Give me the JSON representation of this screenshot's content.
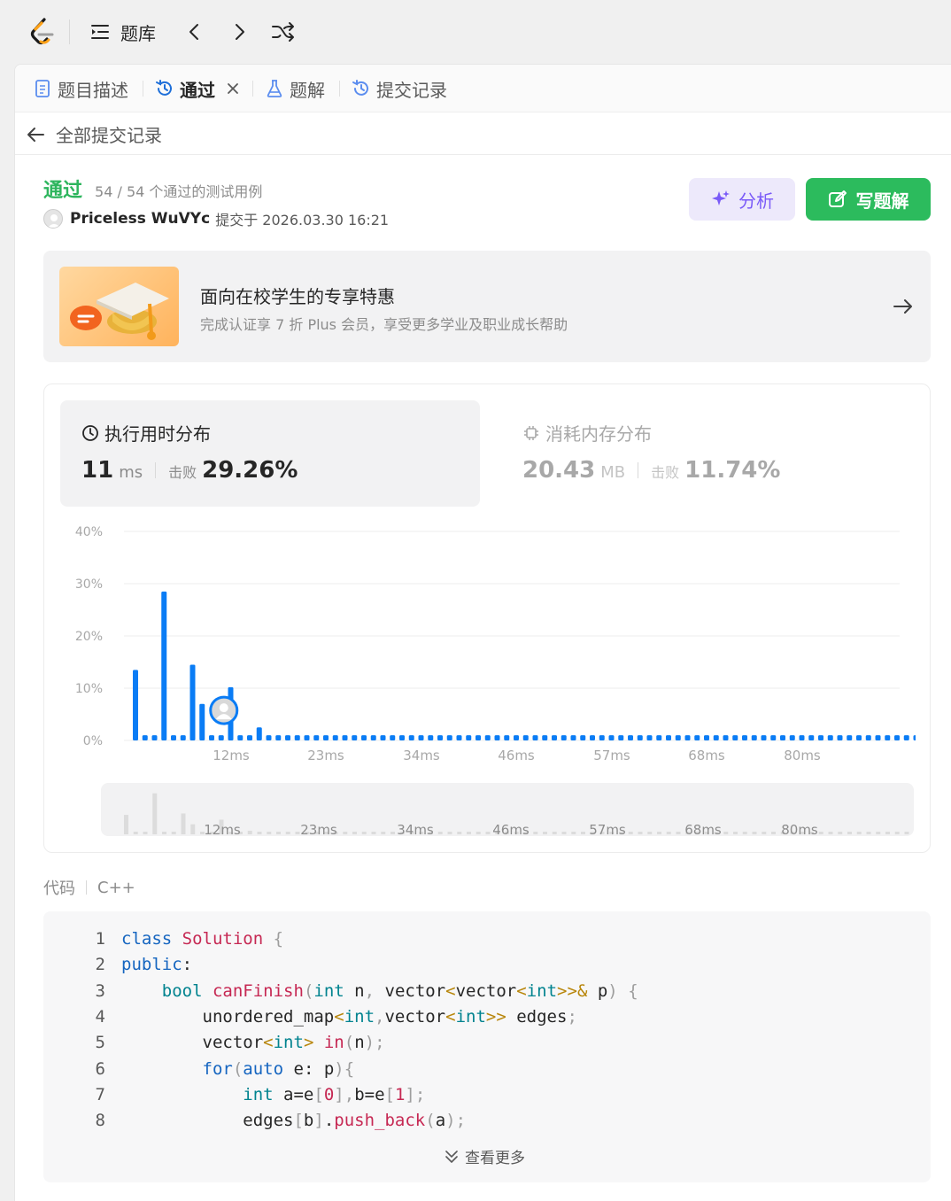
{
  "topbar": {
    "problems_label": "题库"
  },
  "tabs": [
    {
      "label": "题目描述",
      "icon": "document-icon"
    },
    {
      "label": "通过",
      "icon": "history-icon"
    },
    {
      "label": "题解",
      "icon": "flask-icon"
    },
    {
      "label": "提交记录",
      "icon": "history-icon"
    }
  ],
  "subheader": {
    "back_label": "全部提交记录"
  },
  "submission": {
    "status": "通过",
    "detail": "54 / 54 个通过的测试用例",
    "author": "Priceless WuVYc",
    "submitted": "提交于 2026.03.30 16:21"
  },
  "actions": {
    "analyze_label": "分析",
    "write_label": "写题解"
  },
  "promo": {
    "title": "面向在校学生的专享特惠",
    "subtitle": "完成认证享 7 折 Plus 会员，享受更多学业及职业成长帮助"
  },
  "runtime": {
    "title": "执行用时分布",
    "value": "11",
    "unit": "ms",
    "beat_label": "击败",
    "beat": "29.26%"
  },
  "memory": {
    "title": "消耗内存分布",
    "value": "20.43",
    "unit": "MB",
    "beat_label": "击败",
    "beat": "11.74%"
  },
  "chart_data": {
    "type": "bar",
    "ylabel_ticks": [
      "0%",
      "10%",
      "20%",
      "30%",
      "40%"
    ],
    "ylim": [
      0,
      40
    ],
    "xticks": [
      "12ms",
      "23ms",
      "34ms",
      "46ms",
      "57ms",
      "68ms",
      "80ms"
    ],
    "values": [
      13.5,
      1,
      1,
      28.5,
      1,
      1,
      14.5,
      7,
      1,
      1,
      10.2,
      1,
      1,
      2.5,
      1,
      1,
      1,
      1,
      1,
      1,
      1,
      1,
      1,
      1,
      1,
      1,
      1,
      1,
      1,
      1,
      1,
      1,
      1,
      1,
      1,
      1,
      1,
      1,
      1,
      1,
      1,
      1,
      1,
      1,
      1,
      1,
      1,
      1,
      1,
      1,
      1,
      1,
      1,
      1,
      1,
      1,
      1,
      1,
      1,
      1,
      1,
      1,
      1,
      1,
      1,
      1,
      1,
      1,
      1,
      1,
      1,
      1,
      1,
      1,
      1,
      1,
      1,
      1,
      1,
      1,
      1,
      1,
      1
    ],
    "highlight_index": 9,
    "bar_color": "#0a7cf5",
    "grid": true
  },
  "code_section": {
    "title": "代码",
    "language": "C++",
    "more_label": "查看更多"
  },
  "code_lines": [
    {
      "n": "1",
      "text": "class Solution {"
    },
    {
      "n": "2",
      "text": "public:"
    },
    {
      "n": "3",
      "text": "    bool canFinish(int n, vector<vector<int>>& p) {"
    },
    {
      "n": "4",
      "text": "        unordered_map<int,vector<int>> edges;"
    },
    {
      "n": "5",
      "text": "        vector<int> in(n);"
    },
    {
      "n": "6",
      "text": "        for(auto e: p){"
    },
    {
      "n": "7",
      "text": "            int a=e[0],b=e[1];"
    },
    {
      "n": "8",
      "text": "            edges[b].push_back(a);"
    }
  ]
}
